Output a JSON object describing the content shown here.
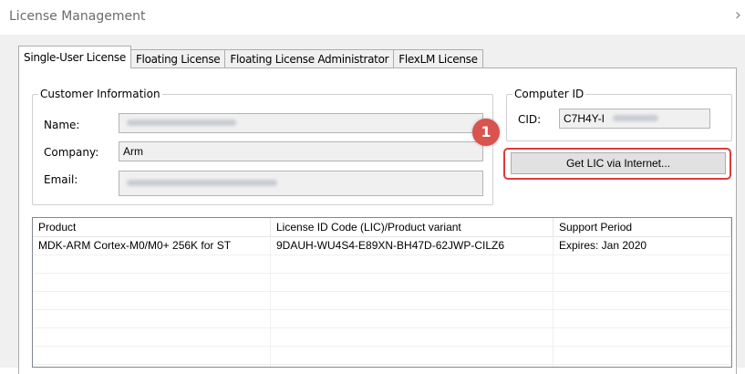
{
  "window": {
    "title": "License Management",
    "close_glyph": "›"
  },
  "tabs": [
    {
      "label": "Single-User License",
      "active": true
    },
    {
      "label": "Floating License",
      "active": false
    },
    {
      "label": "Floating License Administrator",
      "active": false
    },
    {
      "label": "FlexLM License",
      "active": false
    }
  ],
  "customer": {
    "legend": "Customer Information",
    "name_label": "Name:",
    "name_value": "",
    "company_label": "Company:",
    "company_value": "Arm",
    "email_label": "Email:",
    "email_value": ""
  },
  "computer": {
    "legend": "Computer ID",
    "cid_label": "CID:",
    "cid_value": "C7H4Y-I"
  },
  "annotation": {
    "step_number": "1",
    "color": "#e03a3a"
  },
  "get_lic_button": "Get LIC via Internet...",
  "product_table": {
    "columns": [
      "Product",
      "License ID Code (LIC)/Product variant",
      "Support Period"
    ],
    "rows": [
      [
        "MDK-ARM Cortex-M0/M0+ 256K for ST",
        "9DAUH-WU4S4-E89XN-BH47D-62JWP-CILZ6",
        "Expires: Jan 2020"
      ]
    ]
  },
  "colors": {
    "dialog_bg": "#f0f0f0",
    "panel_bg": "#ffffff",
    "highlight": "#e03a3a",
    "badge": "#d9534f"
  }
}
